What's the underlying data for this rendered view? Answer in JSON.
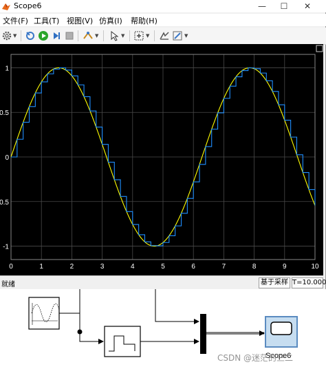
{
  "window": {
    "title": "Scope6",
    "controls": {
      "minimize": "—",
      "maximize": "☐",
      "close": "✕"
    }
  },
  "menu": [
    "文件(F)",
    "工具(T)",
    "视图(V)",
    "仿真(I)",
    "帮助(H)"
  ],
  "toolbar": {
    "icons": [
      "gear-icon",
      "configure-icon",
      "run-icon",
      "step-forward-icon",
      "stop-icon",
      "highlight-icon",
      "cursor-icon",
      "autoscale-icon",
      "measure-icon",
      "style-icon"
    ]
  },
  "status": {
    "text": "就绪",
    "sample_mode": "基于采样",
    "time": "T=10.000"
  },
  "chart_data": {
    "type": "line",
    "xlim": [
      0,
      10
    ],
    "ylim": [
      -1.15,
      1.15
    ],
    "x_ticks": [
      "0",
      "1",
      "2",
      "3",
      "4",
      "5",
      "6",
      "7",
      "8",
      "9",
      "10"
    ],
    "y_ticks": [
      "1",
      "0.5",
      "0",
      "-0.5",
      "-1"
    ],
    "grid": true,
    "background": "#000000",
    "series": [
      {
        "kind": "continuous sine",
        "color": "#ffff00",
        "function": "sin(t)",
        "t_range": [
          0,
          10
        ]
      },
      {
        "kind": "zero-order hold",
        "color": "#1f8fff",
        "sample_time": 0.2,
        "function": "sin(t)",
        "t_range": [
          0,
          10
        ]
      }
    ]
  },
  "diagram": {
    "blocks": [
      "sine-wave-source",
      "zero-order-hold",
      "mux",
      "scope"
    ],
    "scope_label": "Scope6"
  },
  "watermark": "CSDN @迷茫的三二"
}
